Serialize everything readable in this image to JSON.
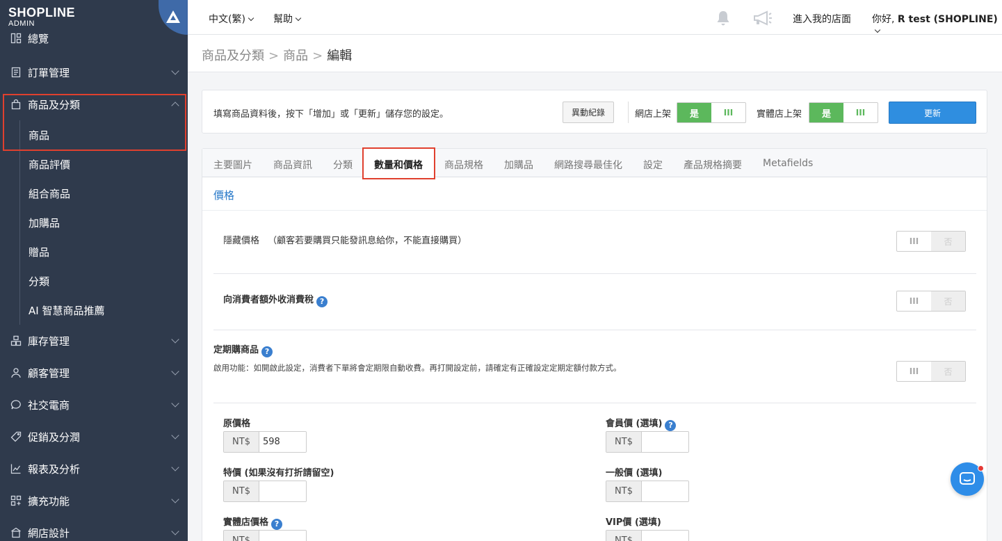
{
  "brand": {
    "name": "SHOPLINE",
    "sub": "ADMIN"
  },
  "sidebar": {
    "items": [
      {
        "label": "總覽",
        "icon": "dashboard-icon"
      },
      {
        "label": "訂單管理",
        "icon": "order-icon"
      },
      {
        "label": "商品及分類",
        "icon": "bag-icon",
        "expanded": true,
        "children": [
          "商品",
          "商品評價",
          "組合商品",
          "加購品",
          "贈品",
          "分類",
          "AI 智慧商品推薦"
        ]
      },
      {
        "label": "庫存管理",
        "icon": "inventory-icon"
      },
      {
        "label": "顧客管理",
        "icon": "user-icon"
      },
      {
        "label": "社交電商",
        "icon": "chat-bubble-icon"
      },
      {
        "label": "促銷及分潤",
        "icon": "tag-icon"
      },
      {
        "label": "報表及分析",
        "icon": "chart-icon"
      },
      {
        "label": "擴充功能",
        "icon": "apps-icon"
      },
      {
        "label": "網店設計",
        "icon": "design-icon"
      }
    ]
  },
  "topbar": {
    "language": "中文(繁)",
    "help": "幫助",
    "store_link": "進入我的店面",
    "greeting": "你好,",
    "user": "R test (SHOPLINE)"
  },
  "breadcrumb": {
    "l1": "商品及分類",
    "l2": "商品",
    "current": "編輯",
    "sep": ">"
  },
  "save_card": {
    "hint": "填寫商品資料後，按下「增加」或「更新」儲存您的設定。",
    "log_button": "異動紀錄",
    "online_label": "網店上架",
    "offline_label": "實體店上架",
    "yes": "是",
    "bars": "III",
    "update_button": "更新"
  },
  "tabs": [
    "主要圖片",
    "商品資訊",
    "分類",
    "數量和價格",
    "商品規格",
    "加購品",
    "網路搜尋最佳化",
    "設定",
    "產品規格摘要",
    "Metafields"
  ],
  "active_tab": "數量和價格",
  "price_section": {
    "title": "價格",
    "hide_price": {
      "label": "隱藏價格",
      "note": "（顧客若要購買只能發訊息給你，不能直接購買）"
    },
    "extra_tax": {
      "label": "向消費者額外收消費稅"
    },
    "subscription": {
      "label": "定期購商品",
      "desc": "啟用功能：如開啟此設定，消費者下單將會定期限自動收費。再打開設定前，請確定有正確設定定期定額付款方式。"
    },
    "toggle_bars": "III",
    "toggle_off": "否",
    "currency": "NT$",
    "help_glyph": "?",
    "fields": {
      "original_price": {
        "label": "原價格",
        "value": "598"
      },
      "member_price": {
        "label": "會員價 (選填)",
        "value": ""
      },
      "sale_price": {
        "label": "特價 (如果沒有打折請留空)",
        "value": ""
      },
      "general_price": {
        "label": "一般價 (選填)",
        "value": ""
      },
      "retail_price": {
        "label": "實體店價格",
        "value": ""
      },
      "vip_price": {
        "label": "VIP價 (選填)",
        "value": ""
      }
    }
  }
}
